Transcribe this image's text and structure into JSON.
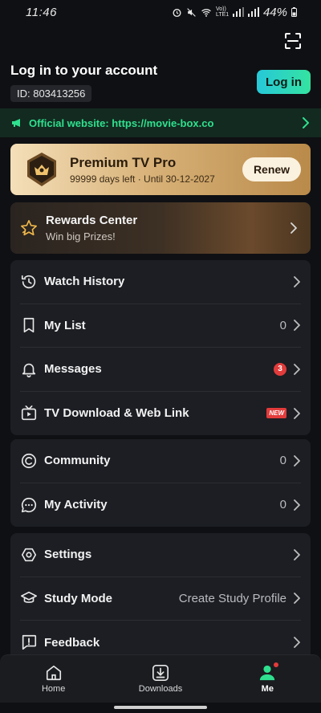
{
  "status_bar": {
    "time": "11:46",
    "network": "Vo)) LTE1",
    "battery": "44%"
  },
  "account": {
    "title": "Log in to your account",
    "id_label": "ID: 803413256",
    "login_label": "Log in"
  },
  "website": {
    "text": "Official website: https://movie-box.co"
  },
  "premium": {
    "title": "Premium TV Pro",
    "subtitle": "99999 days left · Until 30-12-2027",
    "renew_label": "Renew"
  },
  "rewards": {
    "title": "Rewards Center",
    "subtitle": "Win big Prizes!"
  },
  "group1": [
    {
      "label": "Watch History",
      "value": "",
      "icon": "history-icon"
    },
    {
      "label": "My List",
      "value": "0",
      "icon": "bookmark-icon"
    },
    {
      "label": "Messages",
      "badge": "3",
      "icon": "bell-icon"
    },
    {
      "label": "TV Download & Web Link",
      "badge_new": "NEW",
      "icon": "tv-icon"
    }
  ],
  "group2": [
    {
      "label": "Community",
      "value": "0",
      "icon": "community-icon"
    },
    {
      "label": "My Activity",
      "value": "0",
      "icon": "chat-icon"
    }
  ],
  "group3": [
    {
      "label": "Settings",
      "value": "",
      "icon": "settings-icon"
    },
    {
      "label": "Study Mode",
      "value": "Create Study Profile",
      "icon": "graduation-cap-icon"
    },
    {
      "label": "Feedback",
      "value": "",
      "icon": "feedback-icon"
    }
  ],
  "bottom_nav": [
    {
      "label": "Home",
      "icon": "home-icon"
    },
    {
      "label": "Downloads",
      "icon": "download-icon"
    },
    {
      "label": "Me",
      "icon": "profile-icon",
      "active": true
    }
  ],
  "colors": {
    "accent_green": "#2fe08e",
    "login_gradient_start": "#27c8d9",
    "login_gradient_end": "#34e3a0",
    "badge_red": "#e23b3b",
    "card_bg": "#1c1e23",
    "page_bg": "#0f1013"
  }
}
